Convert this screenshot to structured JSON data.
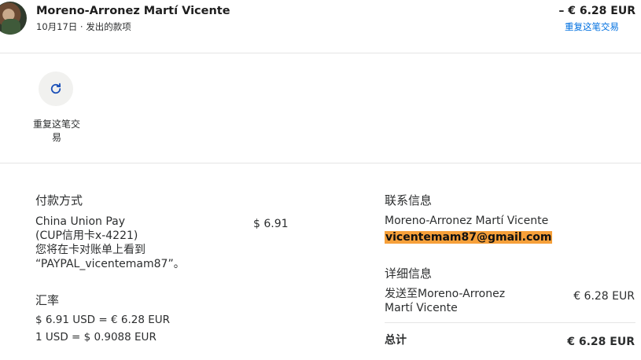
{
  "header": {
    "name": "Moreno-Arronez Martí Vicente",
    "subline": "10月17日 · 发出的款项",
    "amount": "– € 6.28 EUR",
    "repeat_link": "重复这笔交易"
  },
  "repeat_action": {
    "label": "重复这笔交易"
  },
  "payment_method": {
    "title": "付款方式",
    "line1": "China Union Pay",
    "line2": "(CUP信用卡x-4221)",
    "line3": "您将在卡对账单上看到",
    "line4": "“PAYPAL_vicentemam87”。",
    "amount": "$ 6.91"
  },
  "exchange_rate": {
    "title": "汇率",
    "line1": "$ 6.91 USD = € 6.28 EUR",
    "line2": "1 USD = $ 0.9088 EUR"
  },
  "contact": {
    "title": "联系信息",
    "name": "Moreno-Arronez Martí Vicente",
    "email": "vicentemam87@gmail.com"
  },
  "details": {
    "title": "详细信息",
    "sent_to_line1": "发送至Moreno-Arronez",
    "sent_to_line2": "Martí Vicente",
    "sent_amount": "€ 6.28 EUR",
    "total_label": "总计",
    "total_amount": "€ 6.28 EUR"
  },
  "colors": {
    "link": "#0070e0",
    "email_highlight": "#f6a03a"
  },
  "icons": {
    "repeat": "refresh-icon"
  }
}
